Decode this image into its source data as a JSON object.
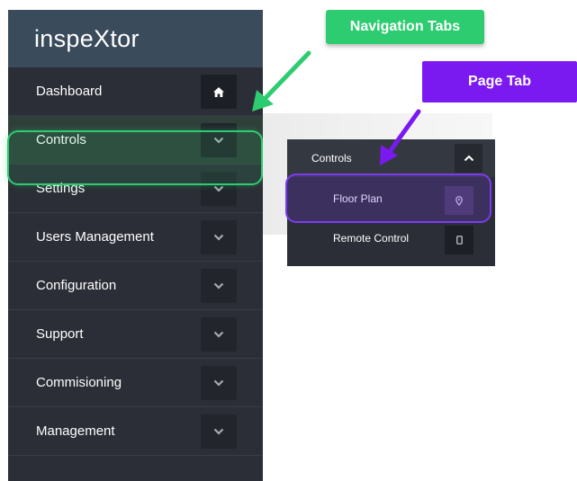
{
  "brand": {
    "title": "inspeXtor"
  },
  "nav": {
    "items": [
      {
        "label": "Dashboard",
        "icon": "home-icon"
      },
      {
        "label": "Controls",
        "icon": "chevron-down-icon"
      },
      {
        "label": "Settings",
        "icon": "chevron-down-icon"
      },
      {
        "label": "Users Management",
        "icon": "chevron-down-icon"
      },
      {
        "label": "Configuration",
        "icon": "chevron-down-icon"
      },
      {
        "label": "Support",
        "icon": "chevron-down-icon"
      },
      {
        "label": "Commisioning",
        "icon": "chevron-down-icon"
      },
      {
        "label": "Management",
        "icon": "chevron-down-icon"
      }
    ]
  },
  "popup": {
    "header": {
      "label": "Controls",
      "icon": "chevron-up-icon"
    },
    "items": [
      {
        "label": "Floor Plan",
        "icon": "map-pin-icon"
      },
      {
        "label": "Remote Control",
        "icon": "mobile-icon"
      }
    ]
  },
  "annotations": {
    "navigation_tabs": "Navigation Tabs",
    "page_tab": "Page Tab"
  },
  "colors": {
    "sidebar_bg": "#2b2e36",
    "brand_bg": "#3a4b5b",
    "annotation_green": "#2ecc71",
    "annotation_purple": "#7a1af0"
  }
}
